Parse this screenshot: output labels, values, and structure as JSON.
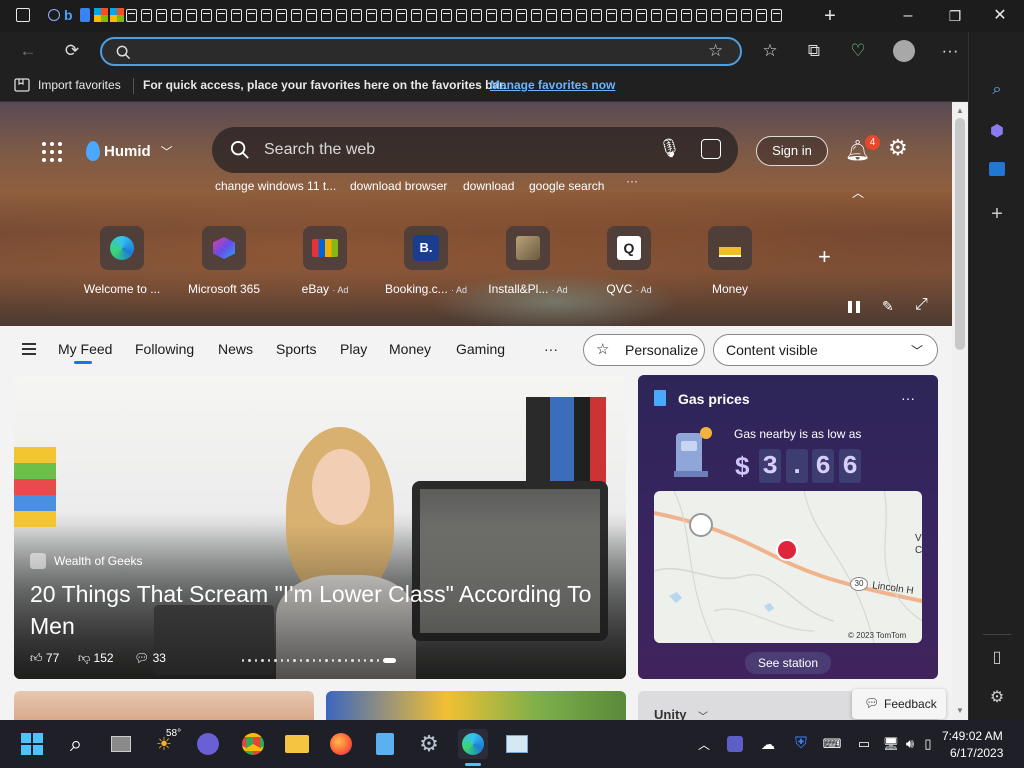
{
  "browser": {
    "new_tab_glyph": "+",
    "minimize_glyph": "–",
    "restore_glyph": "❐",
    "close_glyph": "✕"
  },
  "toolbar": {
    "address_value": "",
    "address_placeholder": ""
  },
  "favorites_bar": {
    "import_label": "Import favorites",
    "hint": "For quick access, place your favorites here on the favorites bar.",
    "manage_link": "Manage favorites now"
  },
  "hero": {
    "weather_label": "Humid",
    "search_placeholder": "Search the web",
    "signin_label": "Sign in",
    "notification_count": "4",
    "suggestions": [
      "change windows 11 t...",
      "download browser",
      "download",
      "google search"
    ],
    "more_dots": "···",
    "quick_links": [
      {
        "label": "Welcome to ...",
        "ad": ""
      },
      {
        "label": "Microsoft 365",
        "ad": ""
      },
      {
        "label": "eBay",
        "ad": "· Ad"
      },
      {
        "label": "Booking.c...",
        "ad": "· Ad"
      },
      {
        "label": "Install&Pl...",
        "ad": "· Ad"
      },
      {
        "label": "QVC",
        "ad": "· Ad"
      },
      {
        "label": "Money",
        "ad": ""
      }
    ]
  },
  "feed": {
    "tabs": [
      "My Feed",
      "Following",
      "News",
      "Sports",
      "Play",
      "Money",
      "Gaming"
    ],
    "more": "···",
    "personalize_label": "Personalize",
    "visibility_select": "Content visible"
  },
  "main_article": {
    "source": "Wealth of Geeks",
    "headline": "20 Things That Scream \"I'm Lower Class\" According To Men",
    "likes": "77",
    "dislikes": "152",
    "comments": "33"
  },
  "gas_card": {
    "title": "Gas prices",
    "more": "···",
    "subtitle": "Gas nearby is as low as",
    "currency": "$",
    "digits": [
      "3",
      ".",
      "6",
      "6"
    ],
    "map_road_label": "Lincoln H",
    "map_route": "30",
    "map_edge_letter_1": "V",
    "map_edge_letter_2": "C",
    "map_credit": "© 2023 TomTom",
    "cta": "See station"
  },
  "bottom": {
    "unity_label": "Unity",
    "feedback_label": "Feedback"
  },
  "taskbar": {
    "weather_temp": "58°",
    "time": "7:49:02 AM",
    "date": "6/17/2023"
  }
}
